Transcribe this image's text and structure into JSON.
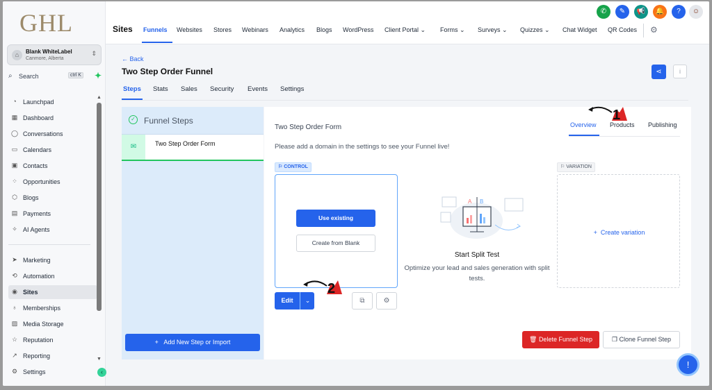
{
  "brand": {
    "logo": "GHL"
  },
  "account": {
    "name": "Blank WhiteLabel",
    "location": "Canmore, Alberta"
  },
  "search": {
    "placeholder": "Search",
    "shortcut": "ctrl K"
  },
  "sidebar": {
    "items": [
      {
        "label": "Launchpad",
        "icon": "rocket-icon"
      },
      {
        "label": "Dashboard",
        "icon": "dashboard-icon"
      },
      {
        "label": "Conversations",
        "icon": "chat-icon"
      },
      {
        "label": "Calendars",
        "icon": "calendar-icon"
      },
      {
        "label": "Contacts",
        "icon": "contacts-icon"
      },
      {
        "label": "Opportunities",
        "icon": "opportunities-icon"
      },
      {
        "label": "Blogs",
        "icon": "blog-icon"
      },
      {
        "label": "Payments",
        "icon": "payments-icon"
      },
      {
        "label": "AI Agents",
        "icon": "sparkle-icon"
      }
    ],
    "items2": [
      {
        "label": "Marketing",
        "icon": "send-icon"
      },
      {
        "label": "Automation",
        "icon": "automation-icon"
      },
      {
        "label": "Sites",
        "icon": "sites-icon",
        "active": true
      },
      {
        "label": "Memberships",
        "icon": "membership-icon"
      },
      {
        "label": "Media Storage",
        "icon": "media-icon"
      },
      {
        "label": "Reputation",
        "icon": "star-icon"
      },
      {
        "label": "Reporting",
        "icon": "chart-icon"
      },
      {
        "label": "Settings",
        "icon": "gear-icon"
      }
    ]
  },
  "topbar": {
    "section": "Sites",
    "menu": [
      "Funnels",
      "Websites",
      "Stores",
      "Webinars",
      "Analytics",
      "Blogs",
      "WordPress",
      "Client Portal ⌄",
      "Forms ⌄",
      "Surveys ⌄",
      "Quizzes ⌄",
      "Chat Widget",
      "QR Codes"
    ],
    "icons": [
      "phone-icon",
      "magic-icon",
      "megaphone-icon",
      "notification-bell-icon",
      "help-icon",
      "user-avatar-icon"
    ]
  },
  "page": {
    "back": "← Back",
    "title": "Two Step Order Funnel",
    "tabs": [
      "Steps",
      "Stats",
      "Sales",
      "Security",
      "Events",
      "Settings"
    ]
  },
  "steps_panel": {
    "header": "Funnel Steps",
    "step_name": "Two Step Order Form",
    "add_button": "Add New Step or Import"
  },
  "step_detail": {
    "title": "Two Step Order Form",
    "tabs": [
      "Overview",
      "Products",
      "Publishing"
    ],
    "notice": "Please add a domain in the settings to see your Funnel live!",
    "control_badge": "CONTROL",
    "variation_badge": "VARIATION",
    "use_existing": "Use existing",
    "create_blank": "Create from Blank",
    "create_variation": "Create variation",
    "split_title": "Start Split Test",
    "split_desc": "Optimize your lead and sales generation with split tests.",
    "edit": "Edit",
    "delete": "Delete Funnel Step",
    "clone": "Clone Funnel Step"
  },
  "annotations": {
    "marker1": "1",
    "marker2": "2"
  },
  "colors": {
    "accent": "#2563eb",
    "danger": "#dc2626",
    "success": "#22c55e"
  }
}
